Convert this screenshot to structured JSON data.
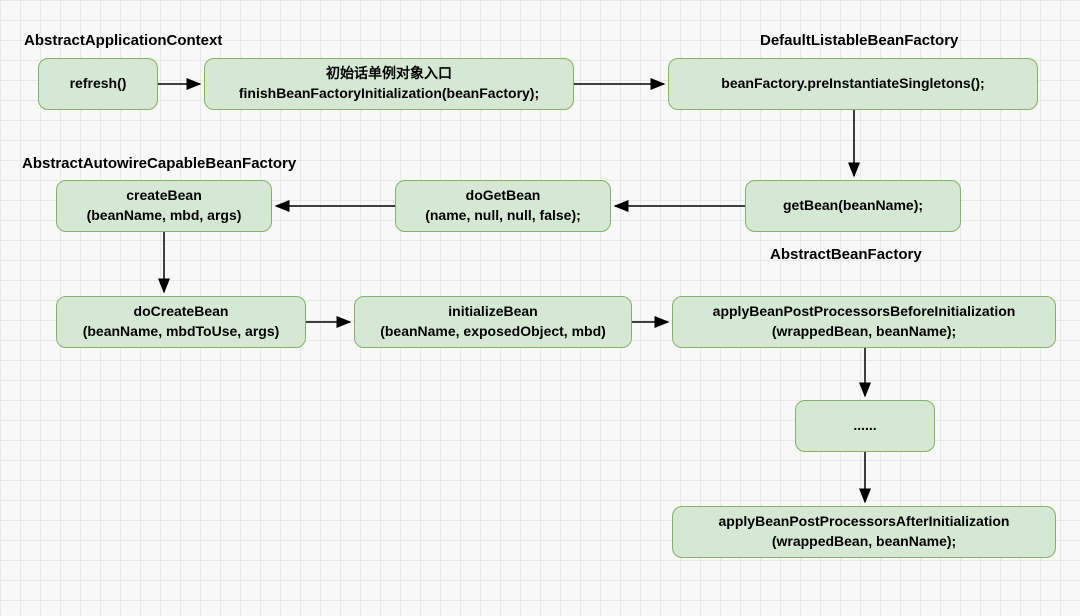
{
  "labels": {
    "label1": "AbstractApplicationContext",
    "label2": "DefaultListableBeanFactory",
    "label3": "AbstractAutowireCapableBeanFactory",
    "label4": "AbstractBeanFactory"
  },
  "nodes": {
    "refresh": "refresh()",
    "finish_line1": "初始话单例对象入口",
    "finish_line2": "finishBeanFactoryInitialization(beanFactory);",
    "preInst": "beanFactory.preInstantiateSingletons();",
    "getBean": "getBean(beanName);",
    "doGetBean_line1": "doGetBean",
    "doGetBean_line2": "(name, null, null, false);",
    "createBean_line1": "createBean",
    "createBean_line2": "(beanName, mbd, args)",
    "doCreateBean_line1": "doCreateBean",
    "doCreateBean_line2": "(beanName, mbdToUse, args)",
    "initBean_line1": "initializeBean",
    "initBean_line2": "(beanName, exposedObject, mbd)",
    "applyBefore_line1": "applyBeanPostProcessorsBeforeInitialization",
    "applyBefore_line2": "(wrappedBean, beanName);",
    "ellipsis": "......",
    "applyAfter_line1": "applyBeanPostProcessorsAfterInitialization",
    "applyAfter_line2": "(wrappedBean, beanName);"
  }
}
